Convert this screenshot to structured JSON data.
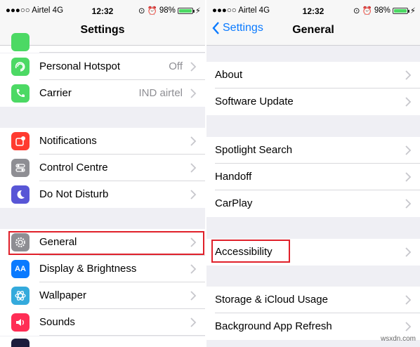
{
  "left": {
    "status": {
      "carrier": "●●●○○ Airtel  4G",
      "time": "12:32",
      "battery": "98%"
    },
    "title": "Settings",
    "rows": [
      {
        "label": "Personal Hotspot",
        "value": "Off",
        "icon": "hotspot-icon",
        "color": "#4cd964"
      },
      {
        "label": "Carrier",
        "value": "IND airtel",
        "icon": "phone-icon",
        "color": "#4cd964"
      },
      {
        "label": "Notifications",
        "value": "",
        "icon": "notifications-icon",
        "color": "#ff3b30"
      },
      {
        "label": "Control Centre",
        "value": "",
        "icon": "control-centre-icon",
        "color": "#8e8e93"
      },
      {
        "label": "Do Not Disturb",
        "value": "",
        "icon": "moon-icon",
        "color": "#5856d6"
      },
      {
        "label": "General",
        "value": "",
        "icon": "gear-icon",
        "color": "#8e8e93"
      },
      {
        "label": "Display & Brightness",
        "value": "",
        "icon": "display-icon",
        "color": "#0a7aff"
      },
      {
        "label": "Wallpaper",
        "value": "",
        "icon": "wallpaper-icon",
        "color": "#34aadc"
      },
      {
        "label": "Sounds",
        "value": "",
        "icon": "speaker-icon",
        "color": "#ff2d55"
      }
    ]
  },
  "right": {
    "status": {
      "carrier": "●●●○○ Airtel  4G",
      "time": "12:32",
      "battery": "98%"
    },
    "back_label": "Settings",
    "title": "General",
    "rows": [
      {
        "label": "About"
      },
      {
        "label": "Software Update"
      },
      {
        "label": "Spotlight Search"
      },
      {
        "label": "Handoff"
      },
      {
        "label": "CarPlay"
      },
      {
        "label": "Accessibility"
      },
      {
        "label": "Storage & iCloud Usage"
      },
      {
        "label": "Background App Refresh"
      }
    ]
  },
  "watermark": "wsxdn.com",
  "colors": {
    "accent": "#0a7aff",
    "highlight": "#e0202a"
  }
}
